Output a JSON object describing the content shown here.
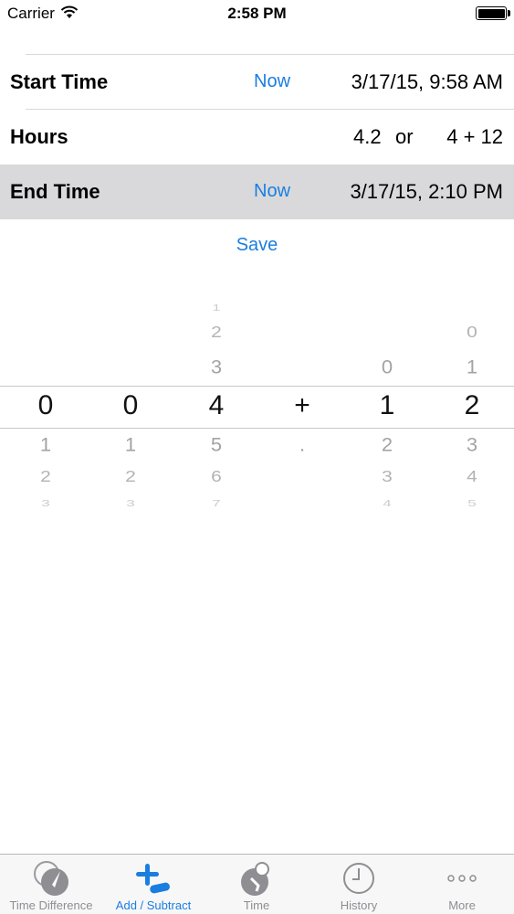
{
  "status_bar": {
    "carrier": "Carrier",
    "time": "2:58 PM"
  },
  "rows": {
    "start": {
      "label": "Start Time",
      "now": "Now",
      "value": "3/17/15, 9:58 AM"
    },
    "hours": {
      "label": "Hours",
      "decimal": "4.2",
      "or": "or",
      "expression": "4 + 12"
    },
    "end": {
      "label": "End Time",
      "now": "Now",
      "value": "3/17/15, 2:10 PM"
    }
  },
  "save_label": "Save",
  "picker": {
    "selected": [
      "0",
      "0",
      "4",
      "+",
      "1",
      "2"
    ],
    "columns": [
      {
        "above": [],
        "below": [
          "1",
          "2",
          "3"
        ]
      },
      {
        "above": [],
        "below": [
          "1",
          "2",
          "3"
        ]
      },
      {
        "above": [
          "1",
          "2",
          "3"
        ],
        "below": [
          "5",
          "6",
          "7"
        ]
      },
      {
        "above": [],
        "below": [
          "."
        ]
      },
      {
        "above": [
          "0"
        ],
        "below": [
          "2",
          "3",
          "4"
        ]
      },
      {
        "above": [
          "0",
          "1"
        ],
        "below": [
          "3",
          "4",
          "5"
        ]
      }
    ]
  },
  "tabs": [
    {
      "label": "Time Difference",
      "icon": "clock-compass-icon",
      "active": false
    },
    {
      "label": "Add / Subtract",
      "icon": "plus-minus-icon",
      "active": true
    },
    {
      "label": "Time",
      "icon": "clock-person-icon",
      "active": false
    },
    {
      "label": "History",
      "icon": "history-clock-icon",
      "active": false
    },
    {
      "label": "More",
      "icon": "more-dots-icon",
      "active": false
    }
  ],
  "colors": {
    "accent": "#1a7ee0",
    "selected_row": "#d9d9db",
    "inactive_tab": "#8e8e93"
  }
}
